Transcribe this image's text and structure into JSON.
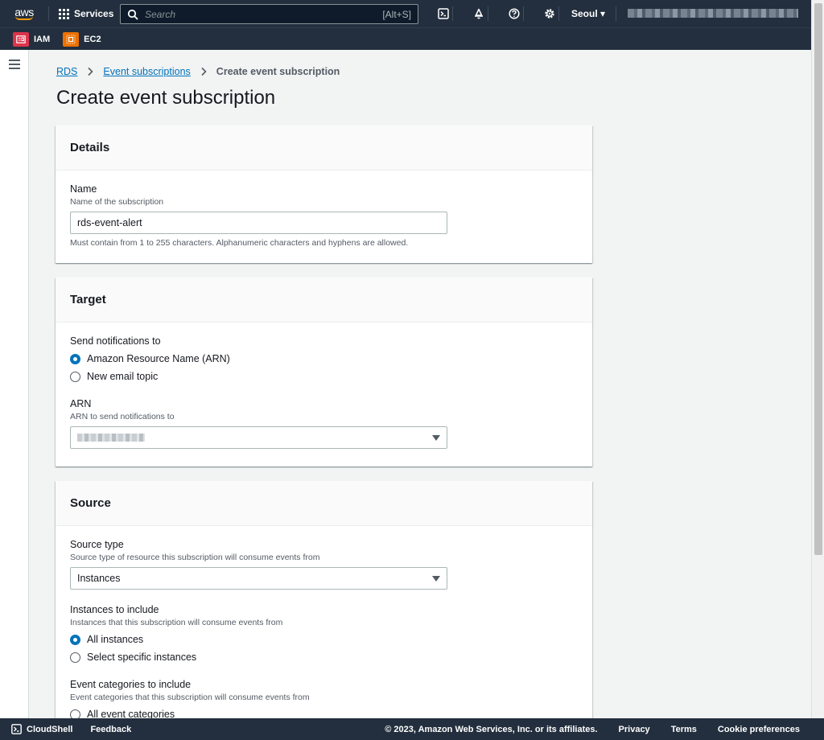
{
  "topnav": {
    "logo_text": "aws",
    "services_label": "Services",
    "search_placeholder": "Search",
    "search_shortcut": "[Alt+S]",
    "region": "Seoul ▾"
  },
  "favorites": [
    {
      "label": "IAM"
    },
    {
      "label": "EC2"
    }
  ],
  "breadcrumbs": {
    "root": "RDS",
    "parent": "Event subscriptions",
    "current": "Create event subscription"
  },
  "page_title": "Create event subscription",
  "details": {
    "header": "Details",
    "name_label": "Name",
    "name_desc": "Name of the subscription",
    "name_value": "rds-event-alert",
    "name_constraint": "Must contain from 1 to 255 characters. Alphanumeric characters and hyphens are allowed."
  },
  "target": {
    "header": "Target",
    "send_label": "Send notifications to",
    "options": [
      "Amazon Resource Name (ARN)",
      "New email topic"
    ],
    "arn_label": "ARN",
    "arn_desc": "ARN to send notifications to"
  },
  "source": {
    "header": "Source",
    "type_label": "Source type",
    "type_desc": "Source type of resource this subscription will consume events from",
    "type_value": "Instances",
    "include_label": "Instances to include",
    "include_desc": "Instances that this subscription will consume events from",
    "include_options": [
      "All instances",
      "Select specific instances"
    ],
    "categories_label": "Event categories to include",
    "categories_desc": "Event categories that this subscription will consume events from",
    "categories_options": [
      "All event categories"
    ]
  },
  "footer": {
    "cloudshell": "CloudShell",
    "feedback": "Feedback",
    "copyright": "© 2023, Amazon Web Services, Inc. or its affiliates.",
    "privacy": "Privacy",
    "terms": "Terms",
    "cookies": "Cookie preferences"
  }
}
